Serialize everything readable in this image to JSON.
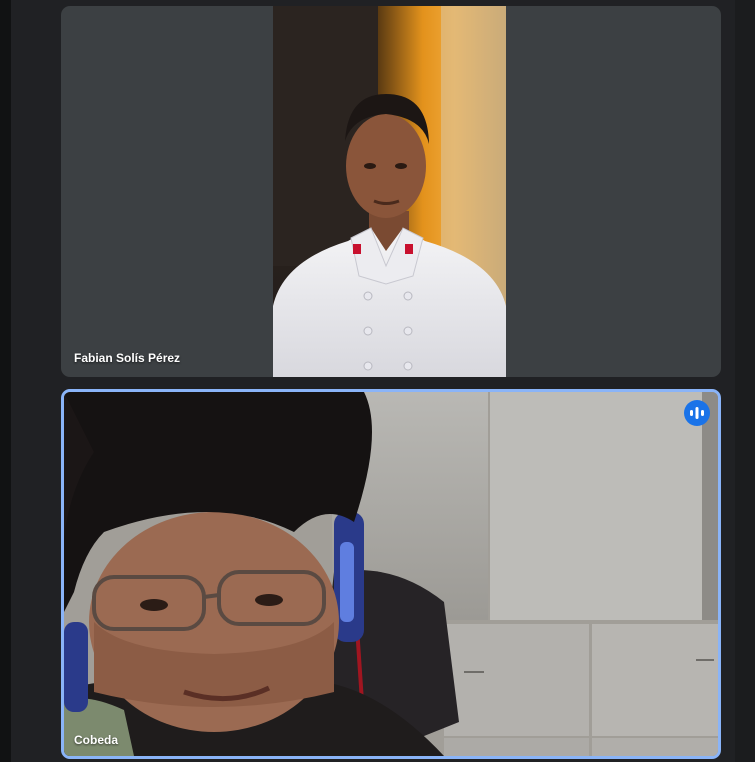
{
  "participants": [
    {
      "name": "Fabian Solís Pérez",
      "active_speaker": false
    },
    {
      "name": "Cobeda",
      "active_speaker": true
    }
  ],
  "icons": {
    "speaking": "audio-level-icon"
  },
  "colors": {
    "background": "#202124",
    "tile": "#3c4043",
    "active_border": "#8ab4f8",
    "speaking_badge": "#1a73e8"
  }
}
